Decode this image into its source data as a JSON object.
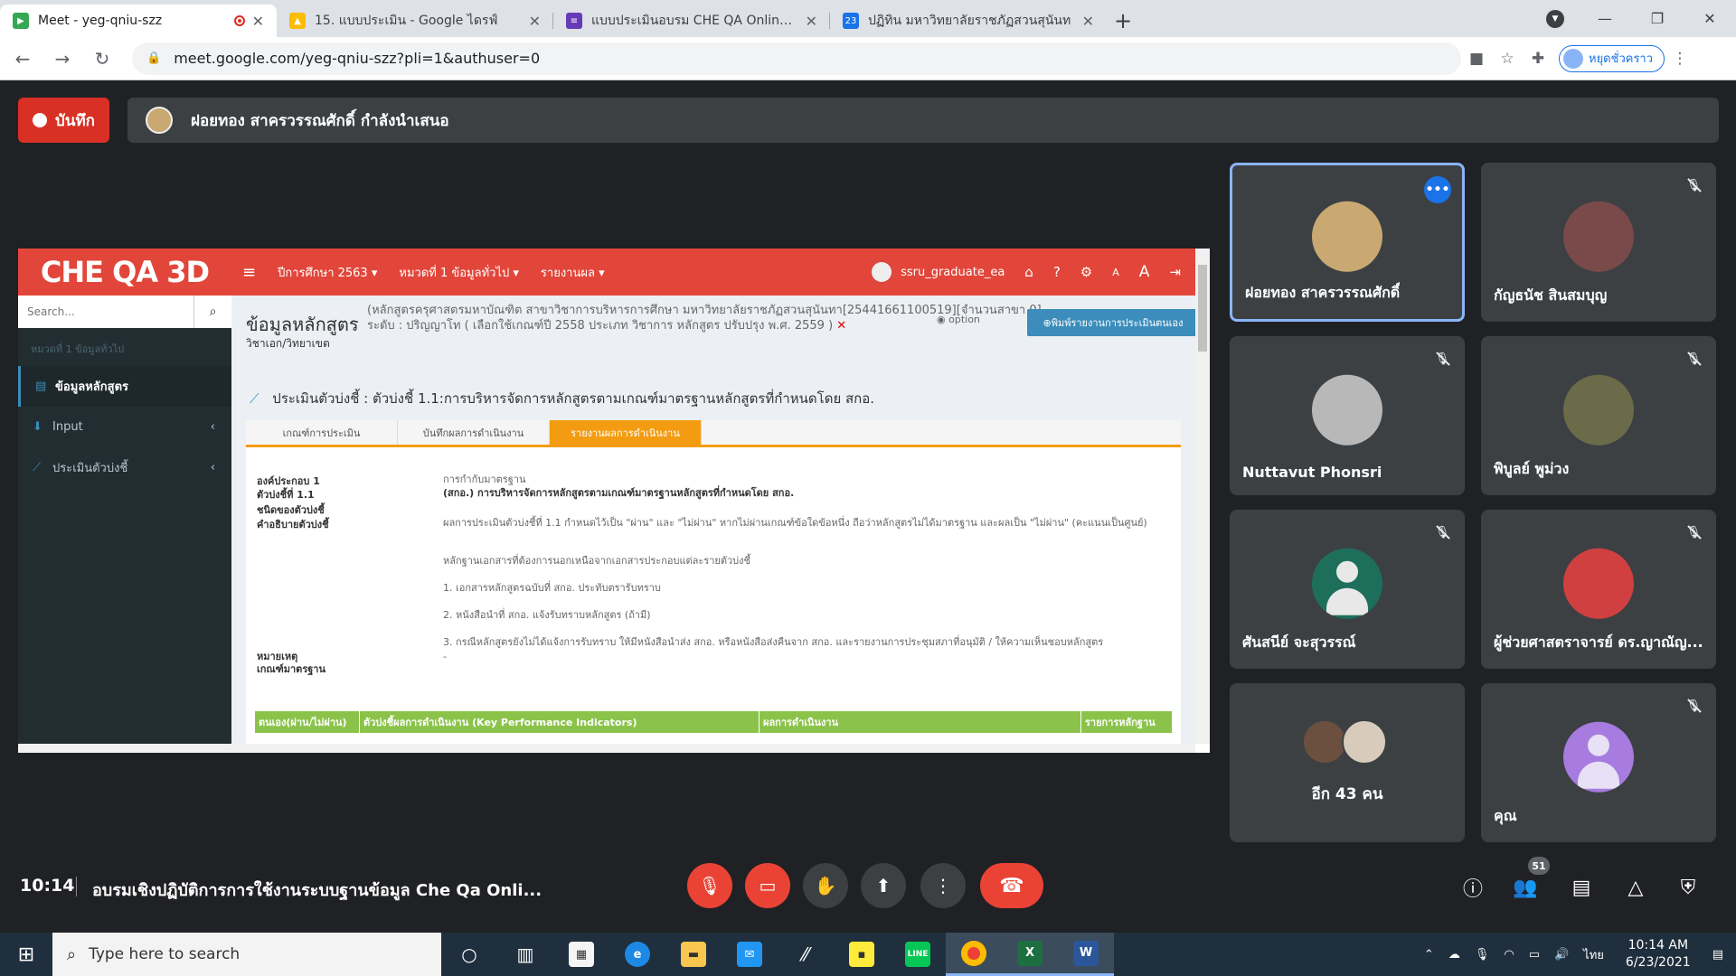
{
  "browser": {
    "tabs": [
      {
        "title": "Meet - yeg-qniu-szz",
        "fav_color": "#34a853",
        "active": true
      },
      {
        "title": "15. แบบประเมิน - Google ไดรฟ์",
        "fav_color": "#fbbc04",
        "active": false
      },
      {
        "title": "แบบประเมินอบรม CHE QA Online 25",
        "fav_color": "#673ab7",
        "active": false
      },
      {
        "title": "ปฏิทิน มหาวิทยาลัยราชภัฏสวนสุนันท",
        "fav_color": "#1a73e8",
        "active": false
      }
    ],
    "new_tab": "+",
    "url": "meet.google.com/yeg-qniu-szz?pli=1&authuser=0",
    "profile_label": "หยุดชั่วคราว"
  },
  "meet": {
    "record_label": "บันทึก",
    "presenter_text": "ฝอยทอง สาครวรรณศักดิ์ กำลังนำเสนอ",
    "time": "10:14",
    "meeting_title": "อบรมเชิงปฏิบัติการการใช้งานระบบฐานข้อมูล Che Qa Onli...",
    "participant_count": "51",
    "tiles": [
      {
        "name": "ฝอยทอง สาครวรรณศักดิ์",
        "speaking": true,
        "color": "#c9a872"
      },
      {
        "name": "กัญธนัช สินสมบุญ",
        "muted": true,
        "color": "#7a4a4a"
      },
      {
        "name": "Nuttavut Phonsri",
        "muted": true,
        "color": "#b8b8b8"
      },
      {
        "name": "พิบูลย์ พูม่วง",
        "muted": true,
        "color": "#6b6b4a"
      },
      {
        "name": "ศันสนีย์ จะสุวรรณ์",
        "muted": true,
        "color": "#e8e8e8"
      },
      {
        "name": "ผู้ช่วยศาสตราจารย์ ดร.ญาณัญ...",
        "muted": true,
        "color": "#d04040"
      },
      {
        "name": "อีก 43 คน",
        "more": true
      },
      {
        "name": "คุณ",
        "muted": true,
        "color": "#e8e8e8"
      }
    ]
  },
  "cheqa": {
    "logo": "CHE QA 3D",
    "menu": [
      "ปีการศึกษา 2563 ▾",
      "หมวดที่ 1 ข้อมูลทั่วไป ▾",
      "รายงานผล ▾"
    ],
    "user": "ssru_graduate_ea",
    "search_placeholder": "Search...",
    "side_header": "หมวดที่ 1 ข้อมูลทั่วไป",
    "side_items": [
      "ข้อมูลหลักสูตร",
      "Input",
      "ประเมินตัวบ่งชี้"
    ],
    "title": "ข้อมูลหลักสูตร",
    "subtitle": "วิชาเอก/วิทยาเขต",
    "meta1": "(หลักสูตรครุศาสตรมหาบัณฑิต สาขาวิชาการบริหารการศึกษา มหาวิทยาลัยราชภัฏสวนสุนันทา[25441661100519][จำนวนสาขา 0]",
    "meta2": "ระดับ : ปริญญาโท ( เลือกใช้เกณฑ์ปี 2558 ประเภท วิชาการ หลักสูตร ปรับปรุง พ.ศ. 2559 )",
    "option": "option",
    "print_button": "พิมพ์รายงานการประเมินตนเอง",
    "kpi_heading": "ประเมินตัวบ่งชี้ : ตัวบ่งชี้ 1.1:การบริหารจัดการหลักสูตรตามเกณฑ์มาตรฐานหลักสูตรที่กำหนดโดย สกอ.",
    "tabs": [
      "เกณฑ์การประเมิน",
      "บันทึกผลการดำเนินงาน",
      "รายงานผลการดำเนินงาน"
    ],
    "rows": [
      {
        "label": "องค์ประกอบ 1",
        "value": "การกำกับมาตรฐาน"
      },
      {
        "label": "ตัวบ่งชี้ที่ 1.1",
        "value": "(สกอ.) การบริหารจัดการหลักสูตรตามเกณฑ์มาตรฐานหลักสูตรที่กำหนดโดย สกอ."
      },
      {
        "label": "ชนิดของตัวบ่งชี้",
        "value": ""
      },
      {
        "label": "คำอธิบายตัวบ่งชี้",
        "value": "ผลการประเมินตัวบ่งชี้ที่ 1.1 กำหนดไว้เป็น \"ผ่าน\" และ \"ไม่ผ่าน\" หากไม่ผ่านเกณฑ์ข้อใดข้อหนึ่ง ถือว่าหลักสูตรไม่ได้มาตรฐาน และผลเป็น \"ไม่ผ่าน\" (คะแนนเป็นศูนย์)"
      }
    ],
    "evidence_intro": "หลักฐานเอกสารที่ต้องการนอกเหนือจากเอกสารประกอบแต่ละรายตัวบ่งชี้",
    "evidence": [
      "1. เอกสารหลักสูตรฉบับที่ สกอ. ประทับตรารับทราบ",
      "2. หนังสือนำที่ สกอ. แจ้งรับทราบหลักสูตร (ถ้ามี)",
      "3. กรณีหลักสูตรยังไม่ได้แจ้งการรับทราบ ให้มีหนังสือนำส่ง สกอ. หรือหนังสือส่งคืนจาก สกอ. และรายงานการประชุมสภาที่อนุมัติ / ให้ความเห็นชอบหลักสูตร"
    ],
    "note_label": "หมายเหตุ",
    "note_label2": "เกณฑ์มาตรฐาน",
    "note_value": "-",
    "table_headers": [
      "ตนเอง(ผ่าน/ไม่ผ่าน)",
      "ตัวบ่งชี้ผลการดำเนินงาน (Key Performance Indicators)",
      "ผลการดำเนินงาน",
      "รายการหลักฐาน"
    ]
  },
  "taskbar": {
    "search_placeholder": "Type here to search",
    "lang": "ไทย",
    "time": "10:14 AM",
    "date": "6/23/2021"
  }
}
